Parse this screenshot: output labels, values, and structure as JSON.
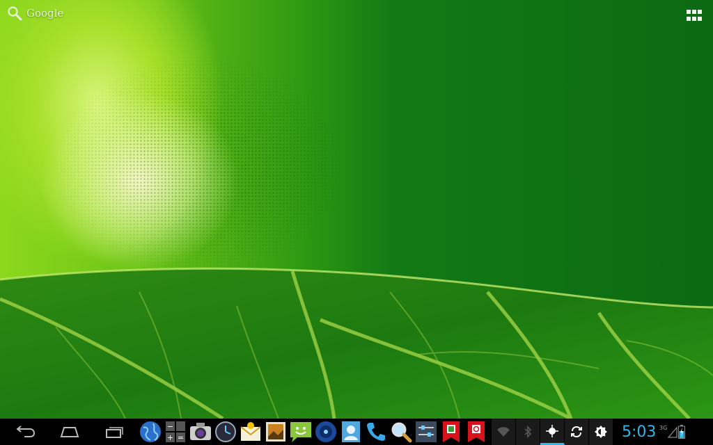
{
  "search": {
    "label": "Google"
  },
  "status": {
    "time": "5:03",
    "network": "3G"
  },
  "colors": {
    "accent": "#33b5e5",
    "navbar": "#000000",
    "wallpaper_dark": "#0c6a12",
    "wallpaper_light": "#a7e02a"
  },
  "navigation": [
    "back-icon",
    "home-icon",
    "recent-apps-icon"
  ],
  "dock": [
    "browser-globe-icon",
    "calculator-icon",
    "camera-icon",
    "clock-icon",
    "email-icon",
    "gallery-icon",
    "messaging-icon",
    "music-icon",
    "contacts-icon",
    "phone-icon",
    "search-app-icon",
    "settings-icon",
    "app-red-bookmark-icon",
    "app-red-sync-icon"
  ],
  "quick_settings": [
    "wifi-icon",
    "bluetooth-icon",
    "gps-icon",
    "sync-icon",
    "brightness-icon"
  ]
}
